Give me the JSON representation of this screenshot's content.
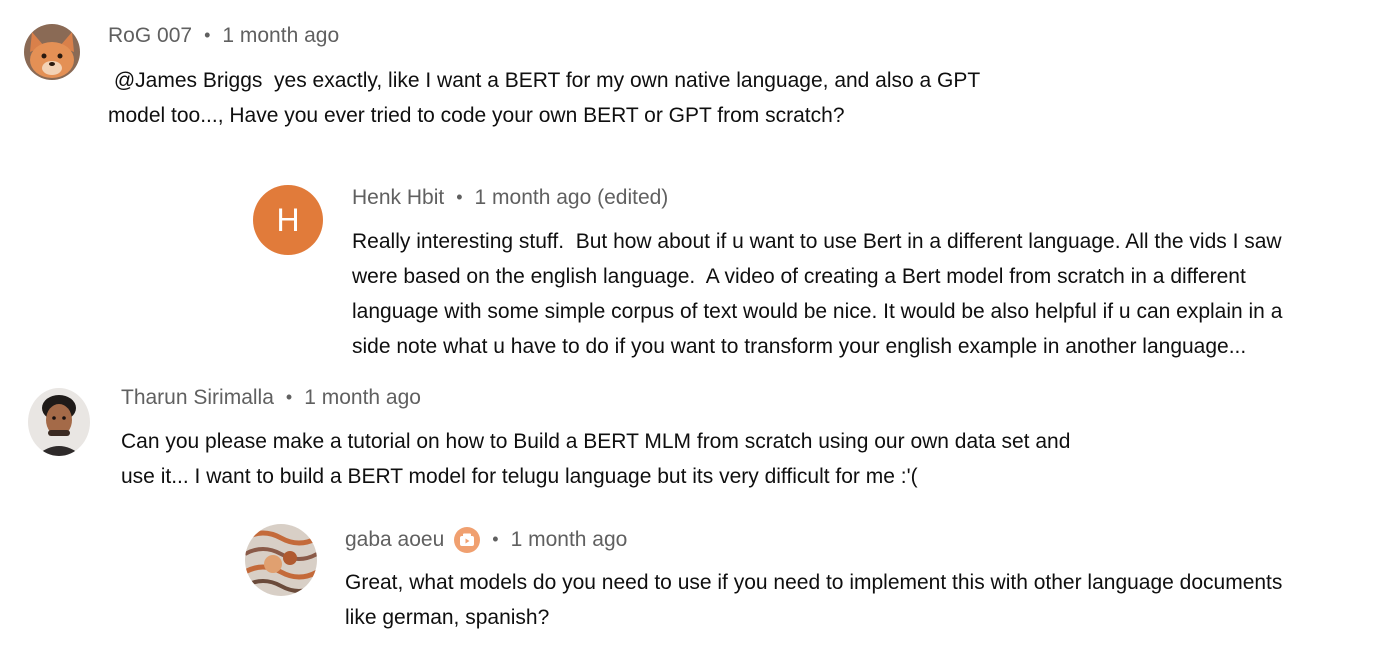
{
  "comments": [
    {
      "author": "RoG 007",
      "time": "1 month ago",
      "text": " @James Briggs  yes exactly, like I want a BERT for my own native language, and also a GPT\nmodel too..., Have you ever tried to code your own BERT or GPT from scratch?"
    },
    {
      "author": "Henk Hbit",
      "time": "1 month ago (edited)",
      "avatar_letter": "H",
      "avatar_color": "#e17b3a",
      "text": "Really interesting stuff.  But how about if u want to use Bert in a different language. All the vids I saw\nwere based on the english language.  A video of creating a Bert model from scratch in a different\nlanguage with some simple corpus of text would be nice. It would be also helpful if u can explain in a\nside note what u have to do if you want to transform your english example in another language..."
    },
    {
      "author": "Tharun Sirimalla",
      "time": "1 month ago",
      "text": "Can you please make a tutorial on how to Build a BERT MLM from scratch using our own data set and\nuse it... I want to build a BERT model for telugu language but its very difficult for me :'("
    },
    {
      "author": "gaba aoeu",
      "time": "1 month ago",
      "badge_icon": "member-badge-icon",
      "text": "Great, what models do you need to use if you need to implement this with other language documents\nlike german, spanish?"
    }
  ],
  "separator": "•"
}
